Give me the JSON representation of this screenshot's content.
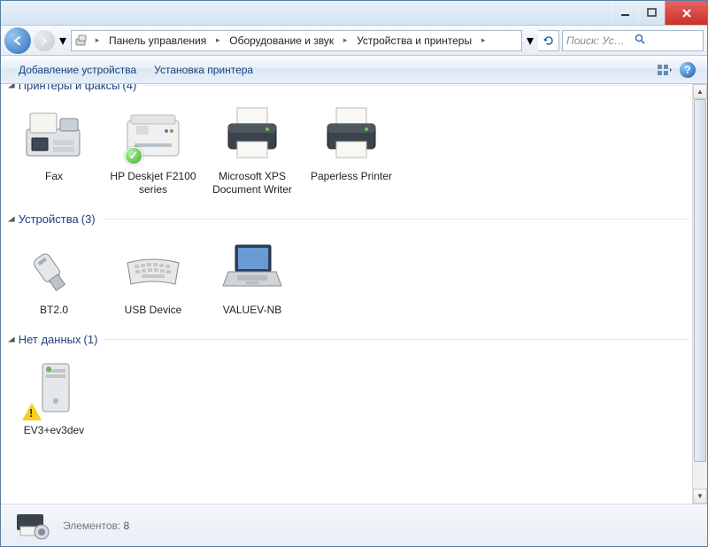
{
  "titlebar": {},
  "nav": {
    "breadcrumb": [
      "Панель управления",
      "Оборудование и звук",
      "Устройства и принтеры"
    ],
    "search_placeholder": "Поиск: Устройства ..."
  },
  "toolbar": {
    "add_device": "Добавление устройства",
    "add_printer": "Установка принтера"
  },
  "groups": [
    {
      "title": "Принтеры и факсы",
      "count": 4,
      "cut": true,
      "items": [
        {
          "name": "Fax",
          "icon": "fax"
        },
        {
          "name": "HP Deskjet F2100 series",
          "icon": "mfp",
          "default": true
        },
        {
          "name": "Microsoft XPS Document Writer",
          "icon": "printer"
        },
        {
          "name": "Paperless Printer",
          "icon": "printer"
        }
      ]
    },
    {
      "title": "Устройства",
      "count": 3,
      "items": [
        {
          "name": "BT2.0",
          "icon": "usb"
        },
        {
          "name": "USB Device",
          "icon": "keyboard"
        },
        {
          "name": "VALUEV-NB",
          "icon": "laptop"
        }
      ]
    },
    {
      "title": "Нет данных",
      "count": 1,
      "items": [
        {
          "name": "EV3+ev3dev",
          "icon": "tower",
          "warn": true
        }
      ]
    }
  ],
  "status": {
    "label": "Элементов:",
    "count": 8
  }
}
